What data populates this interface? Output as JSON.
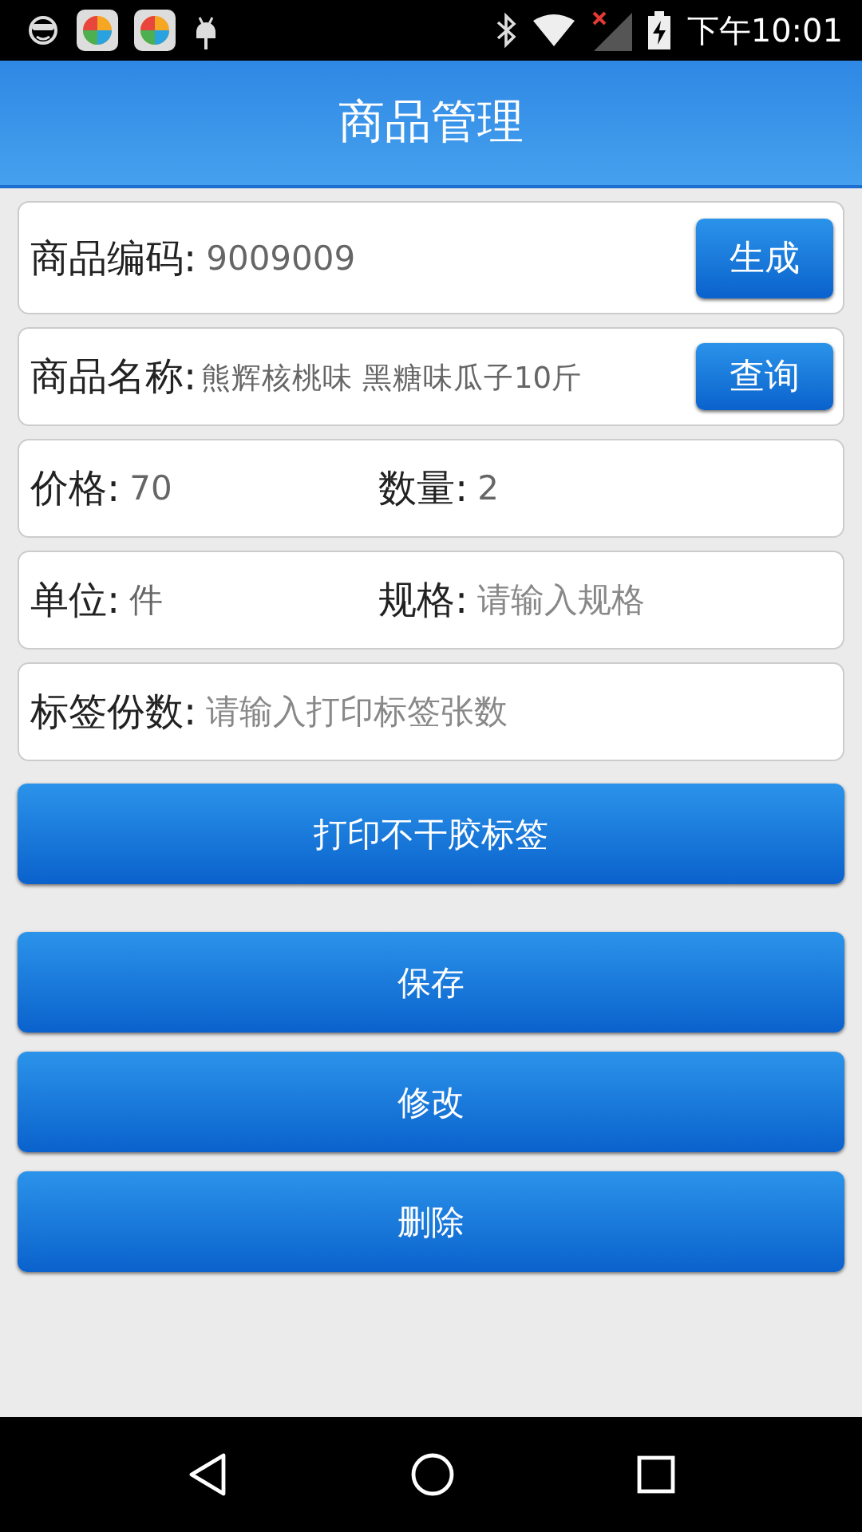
{
  "status_bar": {
    "time": "下午10:01"
  },
  "header": {
    "title": "商品管理"
  },
  "rows": [
    {
      "fields": [
        {
          "label": "商品编码:",
          "value": "9009009"
        }
      ],
      "button": "生成"
    },
    {
      "fields": [
        {
          "label": "商品名称:",
          "value": "熊辉核桃味 黑糖味瓜子10斤"
        }
      ],
      "button": "查询"
    },
    {
      "fields": [
        {
          "label": "价格:",
          "value": "70"
        },
        {
          "label": "数量:",
          "value": "2"
        }
      ]
    },
    {
      "fields": [
        {
          "label": "单位:",
          "value": "件"
        },
        {
          "label": "规格:",
          "placeholder": "请输入规格"
        }
      ]
    },
    {
      "fields": [
        {
          "label": "标签份数:",
          "placeholder": "请输入打印标签张数"
        }
      ]
    }
  ],
  "actions": [
    {
      "label": "打印不干胶标签"
    },
    {
      "label": "保存"
    },
    {
      "label": "修改"
    },
    {
      "label": "删除"
    }
  ]
}
